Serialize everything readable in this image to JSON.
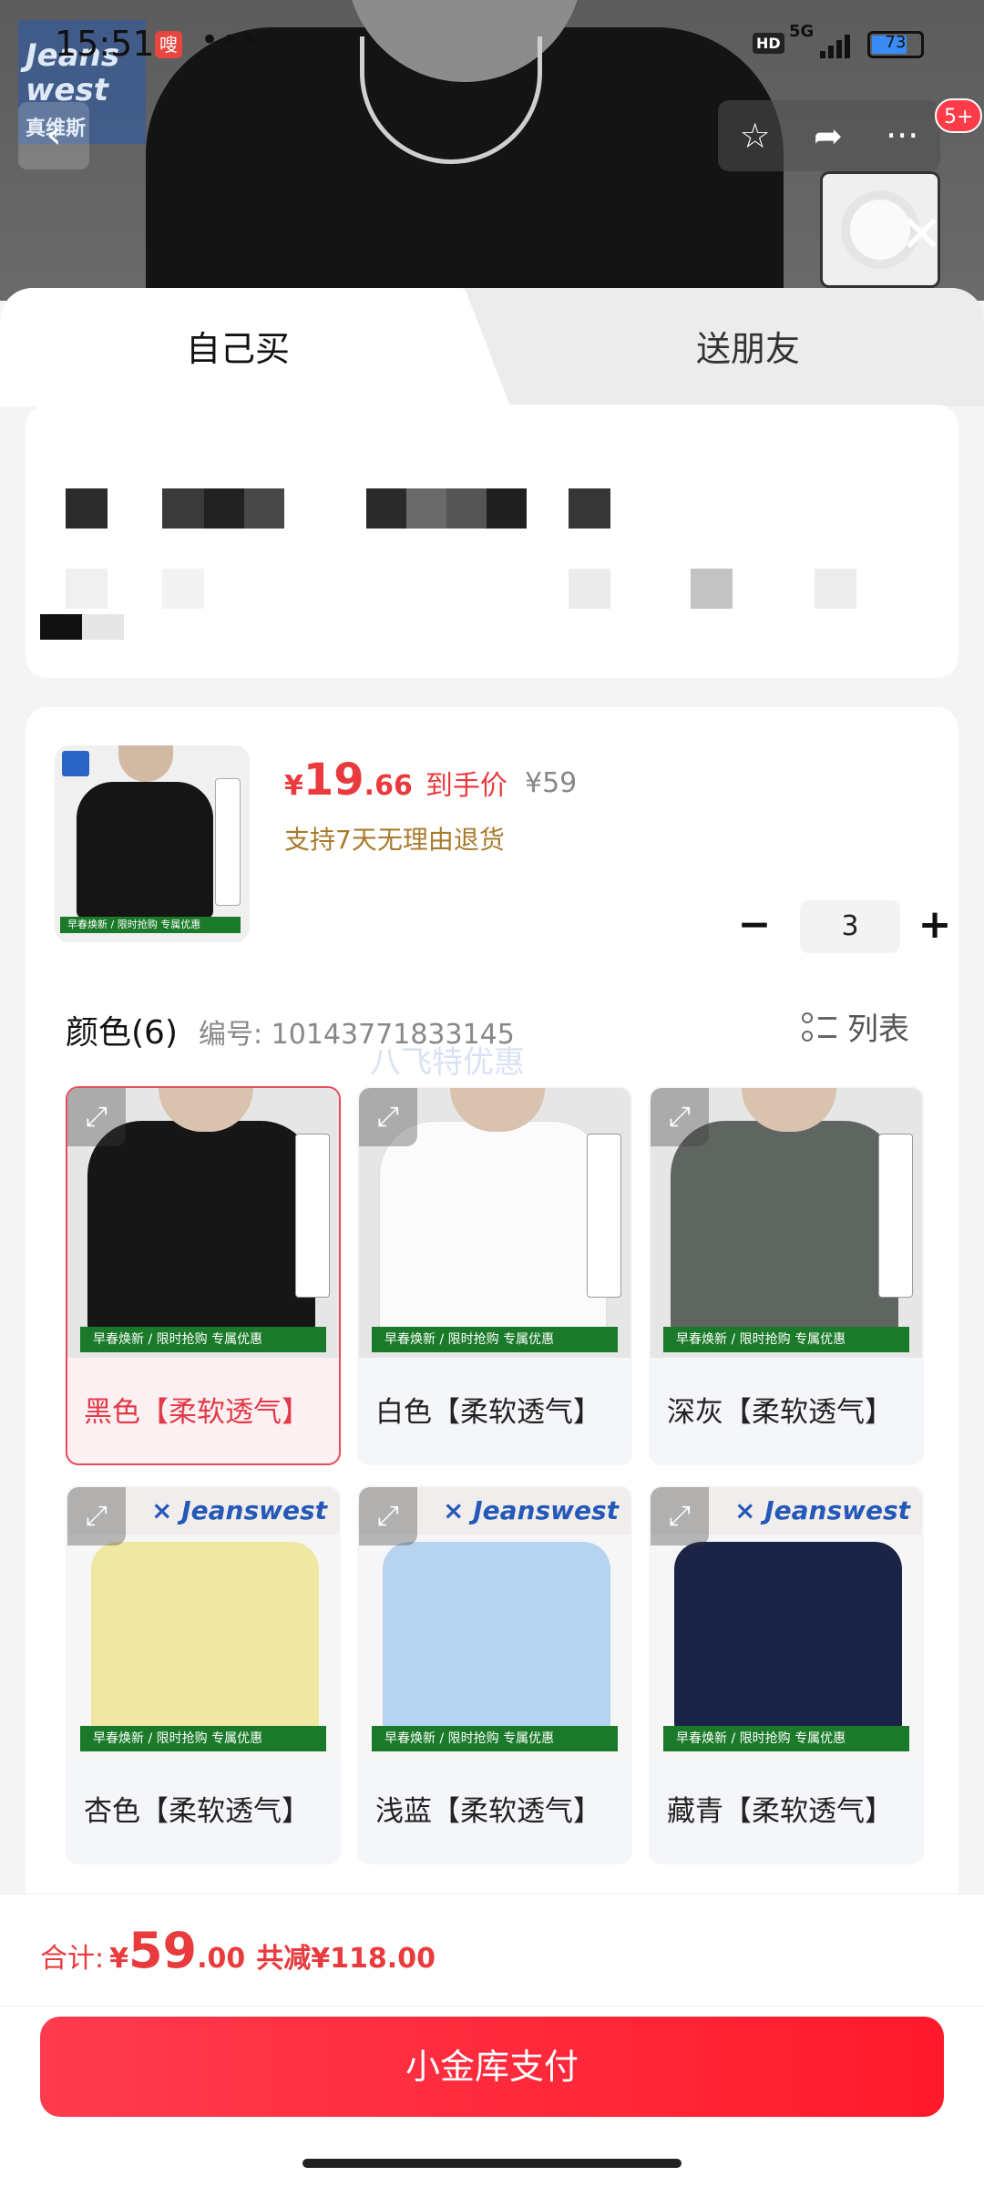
{
  "status_bar": {
    "time": "15:51",
    "app_badge": "嗖",
    "more": "•••",
    "hd": "HD",
    "network": "5G",
    "battery": "73"
  },
  "header_image": {
    "watermark_brand": "Jeans west",
    "watermark_cn": "真维斯"
  },
  "tabs": [
    {
      "label": "自己买",
      "active": true
    },
    {
      "label": "送朋友",
      "active": false
    }
  ],
  "notification_count": "5+",
  "product": {
    "price_symbol": "¥",
    "price_integer": "19",
    "price_decimal": ".66",
    "price_tag": "到手价",
    "original_price": "¥59",
    "return_policy": "支持7天无理由退货",
    "thumb_strip": "早春焕新   /   限时抢购 专属优惠",
    "quantity": "3",
    "minus": "−",
    "plus": "+"
  },
  "variants_section": {
    "title": "颜色(6)",
    "sku_label": "编号: 10143771833145",
    "watermark": "八飞特优惠",
    "list_label": "列表"
  },
  "variants": [
    {
      "label": "黑色【柔软透气】",
      "color": "#161616",
      "selected": true,
      "style": "model"
    },
    {
      "label": "白色【柔软透气】",
      "color": "#fbfbfb",
      "selected": false,
      "style": "model"
    },
    {
      "label": "深灰【柔软透气】",
      "color": "#5f6560",
      "selected": false,
      "style": "model"
    },
    {
      "label": "杏色【柔软透气】",
      "color": "#efe8a2",
      "selected": false,
      "style": "flat"
    },
    {
      "label": "浅蓝【柔软透气】",
      "color": "#b6d3ef",
      "selected": false,
      "style": "flat"
    },
    {
      "label": "藏青【柔软透气】",
      "color": "#1b2346",
      "selected": false,
      "style": "flat"
    }
  ],
  "variant_strip": "早春焕新   /   限时抢购 专属优惠",
  "variant_brand": "× Jeanswest",
  "footer": {
    "total_label": "合计:",
    "total_symbol": "¥",
    "total_integer": "59",
    "total_decimal": ".00",
    "discount": "共减¥118.00",
    "pay_button": "小金库支付"
  },
  "colors": {
    "accent": "#e93b3d",
    "return_note": "#a97b2c",
    "selected_border": "#e84a5a",
    "strip_green": "#1b7a2a"
  }
}
